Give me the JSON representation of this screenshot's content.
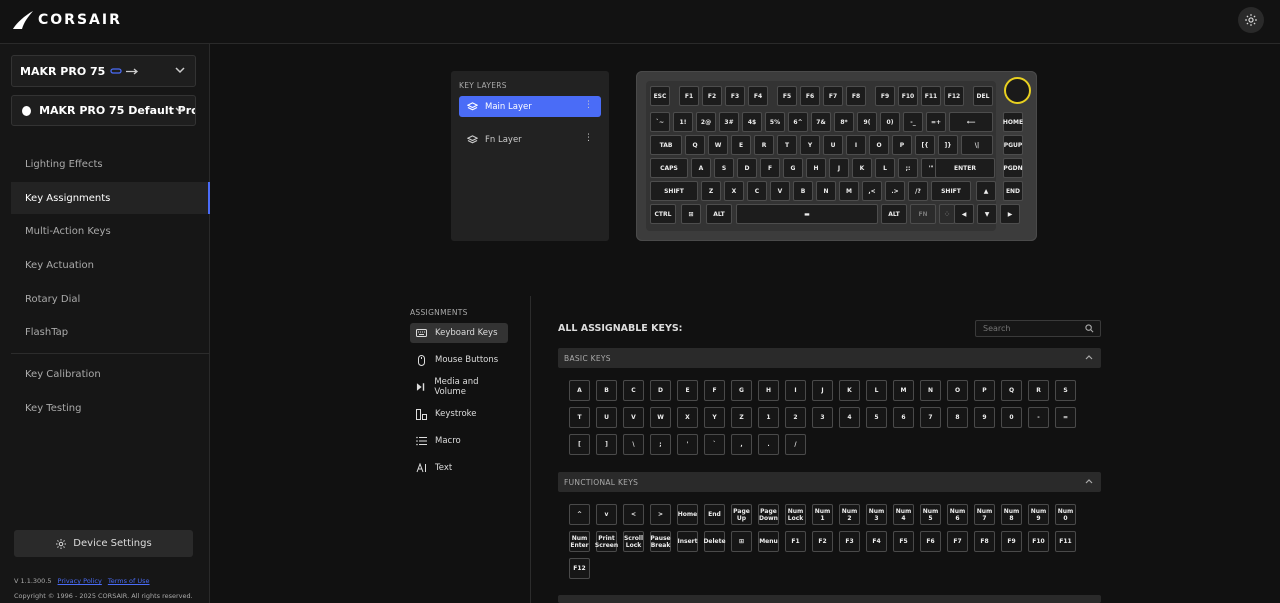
{
  "app": {
    "brand": "CORSAIR"
  },
  "sidebar": {
    "device": {
      "name": "MAKR PRO 75"
    },
    "profile": {
      "name": "MAKR PRO 75 Default Pro..."
    },
    "nav": [
      "Lighting Effects",
      "Key Assignments",
      "Multi-Action Keys",
      "Key Actuation",
      "Rotary Dial",
      "FlashTap"
    ],
    "nav2": [
      "Key Calibration",
      "Key Testing"
    ],
    "device_settings": "Device Settings",
    "version": "V 1.1.300.5",
    "privacy": "Privacy Policy",
    "terms": "Terms of Use",
    "copyright": "Copyright © 1996 - 2025 CORSAIR. All rights reserved."
  },
  "layers": {
    "title": "KEY LAYERS",
    "items": [
      "Main Layer",
      "Fn Layer"
    ]
  },
  "keyboard": {
    "rows": [
      [
        "ESC",
        "F1",
        "F2",
        "F3",
        "F4",
        "F5",
        "F6",
        "F7",
        "F8",
        "F9",
        "F10",
        "F11",
        "F12",
        "DEL"
      ],
      [
        "`~",
        "1!",
        "2@",
        "3#",
        "4$",
        "5%",
        "6^",
        "7&",
        "8*",
        "9(",
        "0)",
        "-_",
        "=+",
        "⟵",
        "HOME"
      ],
      [
        "TAB",
        "Q",
        "W",
        "E",
        "R",
        "T",
        "Y",
        "U",
        "I",
        "O",
        "P",
        "[{",
        "]}",
        "\\|",
        "PGUP"
      ],
      [
        "CAPS",
        "A",
        "S",
        "D",
        "F",
        "G",
        "H",
        "J",
        "K",
        "L",
        ";:",
        "'\"",
        "ENTER",
        "PGDN"
      ],
      [
        "SHIFT",
        "Z",
        "X",
        "C",
        "V",
        "B",
        "N",
        "M",
        ",<",
        ".>",
        "/?",
        "SHIFT",
        "▲",
        "END"
      ],
      [
        "CTRL",
        "⊞",
        "ALT",
        "▬",
        "ALT",
        "FN",
        "⁘",
        "◀",
        "▼",
        "▶"
      ]
    ]
  },
  "assignments": {
    "title": "ASSIGNMENTS",
    "items": [
      "Keyboard Keys",
      "Mouse Buttons",
      "Media and Volume",
      "Keystroke",
      "Macro",
      "Text"
    ],
    "all_title": "ALL ASSIGNABLE KEYS:",
    "search_placeholder": "Search",
    "basic_title": "BASIC KEYS",
    "basic_keys": [
      "A",
      "B",
      "C",
      "D",
      "E",
      "F",
      "G",
      "H",
      "I",
      "J",
      "K",
      "L",
      "M",
      "N",
      "O",
      "P",
      "Q",
      "R",
      "S",
      "T",
      "U",
      "V",
      "W",
      "X",
      "Y",
      "Z",
      "1",
      "2",
      "3",
      "4",
      "5",
      "6",
      "7",
      "8",
      "9",
      "0",
      "-",
      "=",
      "[",
      "]",
      "\\",
      ";",
      "'",
      "`",
      ",",
      ".",
      "/"
    ],
    "functional_title": "FUNCTIONAL KEYS",
    "functional_keys": [
      "^",
      "v",
      "<",
      ">",
      "Home",
      "End",
      "Page Up",
      "Page Down",
      "Num Lock",
      "Num 1",
      "Num 2",
      "Num 3",
      "Num 4",
      "Num 5",
      "Num 6",
      "Num 7",
      "Num 8",
      "Num 9",
      "Num 0",
      "Num Enter",
      "Print Screen",
      "Scroll Lock",
      "Pause Break",
      "Insert",
      "Delete",
      "⊞",
      "Menu",
      "F1",
      "F2",
      "F3",
      "F4",
      "F5",
      "F6",
      "F7",
      "F8",
      "F9",
      "F10",
      "F11",
      "F12"
    ]
  }
}
